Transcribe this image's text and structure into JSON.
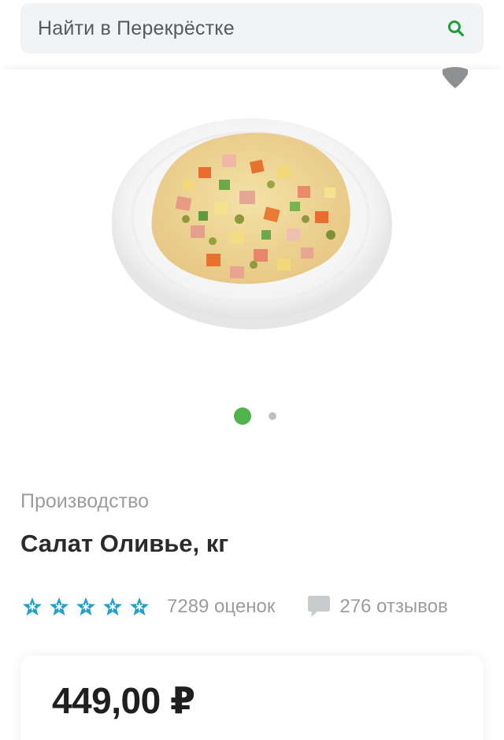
{
  "search": {
    "placeholder": "Найти в Перекрёстке",
    "icon": "search-icon",
    "icon_color": "#1f9d3c"
  },
  "gallery": {
    "favorite_icon": "heart-icon",
    "image": "salad-olivier-plate",
    "pager": {
      "total": 2,
      "active": 1
    },
    "accent_color": "#4fb24a"
  },
  "product": {
    "manufacturer": "Производство",
    "title": "Салат Оливье, кг",
    "rating": {
      "stars": 5,
      "star_color": "#1ea0c9",
      "ratings_label": "7289 оценок",
      "reviews_label": "276 отзывов",
      "review_icon": "comment-icon"
    },
    "price": "449,00 ₽"
  }
}
